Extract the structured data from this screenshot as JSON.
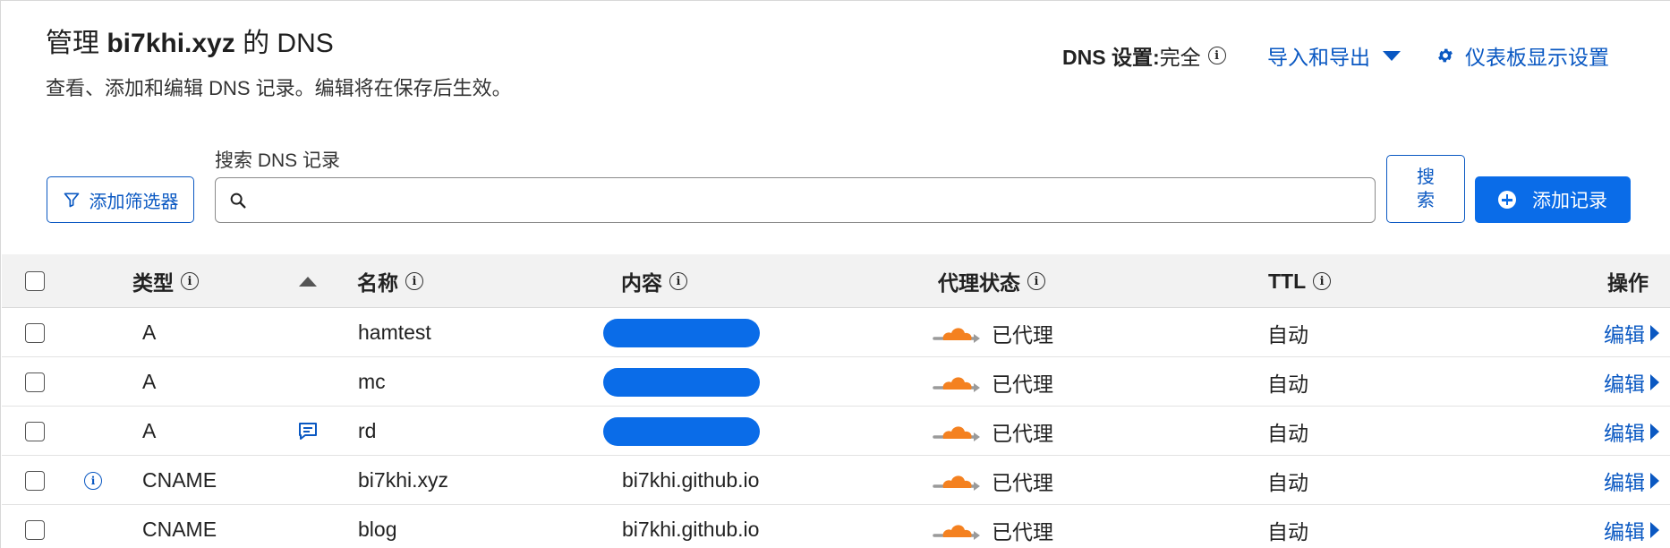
{
  "header": {
    "title_prefix": "管理",
    "domain": "bi7khi.xyz",
    "title_suffix": "的 DNS",
    "subtitle": "查看、添加和编辑 DNS 记录。编辑将在保存后生效。",
    "dns_setting_label": "DNS 设置:",
    "dns_setting_value": "完全",
    "import_export": "导入和导出",
    "dashboard_settings": "仪表板显示设置"
  },
  "toolbar": {
    "filter_label": "添加筛选器",
    "search_label": "搜索 DNS 记录",
    "search_value": "",
    "search_button": "搜\n索",
    "add_record": "添加记录"
  },
  "table": {
    "columns": {
      "type": "类型",
      "name": "名称",
      "content": "内容",
      "proxy": "代理状态",
      "ttl": "TTL",
      "actions": "操作"
    },
    "rows": [
      {
        "type": "A",
        "name": "hamtest",
        "content": "",
        "content_redacted": true,
        "proxy": "已代理",
        "ttl": "自动",
        "edit": "编辑",
        "has_comment": false,
        "has_info": false
      },
      {
        "type": "A",
        "name": "mc",
        "content": "",
        "content_redacted": true,
        "proxy": "已代理",
        "ttl": "自动",
        "edit": "编辑",
        "has_comment": false,
        "has_info": false
      },
      {
        "type": "A",
        "name": "rd",
        "content": "",
        "content_redacted": true,
        "proxy": "已代理",
        "ttl": "自动",
        "edit": "编辑",
        "has_comment": true,
        "has_info": false
      },
      {
        "type": "CNAME",
        "name": "bi7khi.xyz",
        "content": "bi7khi.github.io",
        "content_redacted": false,
        "proxy": "已代理",
        "ttl": "自动",
        "edit": "编辑",
        "has_comment": false,
        "has_info": true
      },
      {
        "type": "CNAME",
        "name": "blog",
        "content": "bi7khi.github.io",
        "content_redacted": false,
        "proxy": "已代理",
        "ttl": "自动",
        "edit": "编辑",
        "has_comment": false,
        "has_info": false
      }
    ]
  },
  "colors": {
    "accent": "#0a58c2",
    "primary_button": "#0a6ce8",
    "cloud_orange": "#f48120",
    "header_bg": "#f2f2f2"
  }
}
